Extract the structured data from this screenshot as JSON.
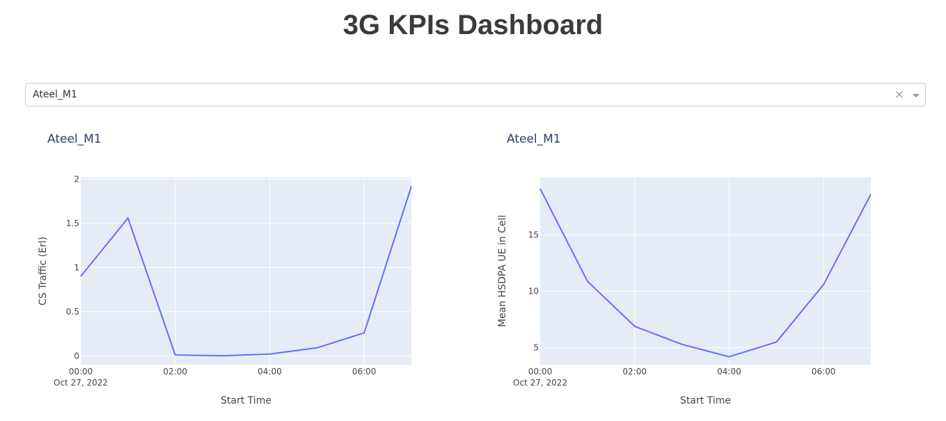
{
  "header": {
    "title": "3G KPIs Dashboard"
  },
  "dropdown": {
    "value": "Ateel_M1",
    "clear_icon": "×"
  },
  "colors": {
    "line": "#636efa",
    "plot_bg": "#e5ecf6",
    "grid": "#ffffff"
  },
  "chart_data": [
    {
      "type": "line",
      "title": "Ateel_M1",
      "xlabel": "Start Time",
      "ylabel": "CS Traffic (Erl)",
      "x": [
        "00:00",
        "01:00",
        "02:00",
        "03:00",
        "04:00",
        "05:00",
        "06:00",
        "07:00"
      ],
      "x_date": "Oct 27, 2022",
      "x_ticks": [
        "00:00",
        "02:00",
        "04:00",
        "06:00"
      ],
      "y_ticks": [
        "0",
        "0.5",
        "1",
        "1.5",
        "2"
      ],
      "ylim": [
        -0.1,
        2.02
      ],
      "series": [
        {
          "values": [
            0.9,
            1.56,
            0.01,
            0.0,
            0.02,
            0.09,
            0.26,
            1.92
          ]
        }
      ]
    },
    {
      "type": "line",
      "title": "Ateel_M1",
      "xlabel": "Start Time",
      "ylabel": "Mean HSDPA UE in Cell",
      "x": [
        "00:00",
        "01:00",
        "02:00",
        "03:00",
        "04:00",
        "05:00",
        "06:00",
        "07:00"
      ],
      "x_date": "Oct 27, 2022",
      "x_ticks": [
        "00:00",
        "02:00",
        "04:00",
        "06:00"
      ],
      "y_ticks": [
        "5",
        "10",
        "15"
      ],
      "ylim": [
        3.5,
        20.1
      ],
      "series": [
        {
          "values": [
            19.1,
            10.9,
            6.9,
            5.3,
            4.2,
            5.5,
            10.6,
            18.6
          ]
        }
      ]
    }
  ]
}
